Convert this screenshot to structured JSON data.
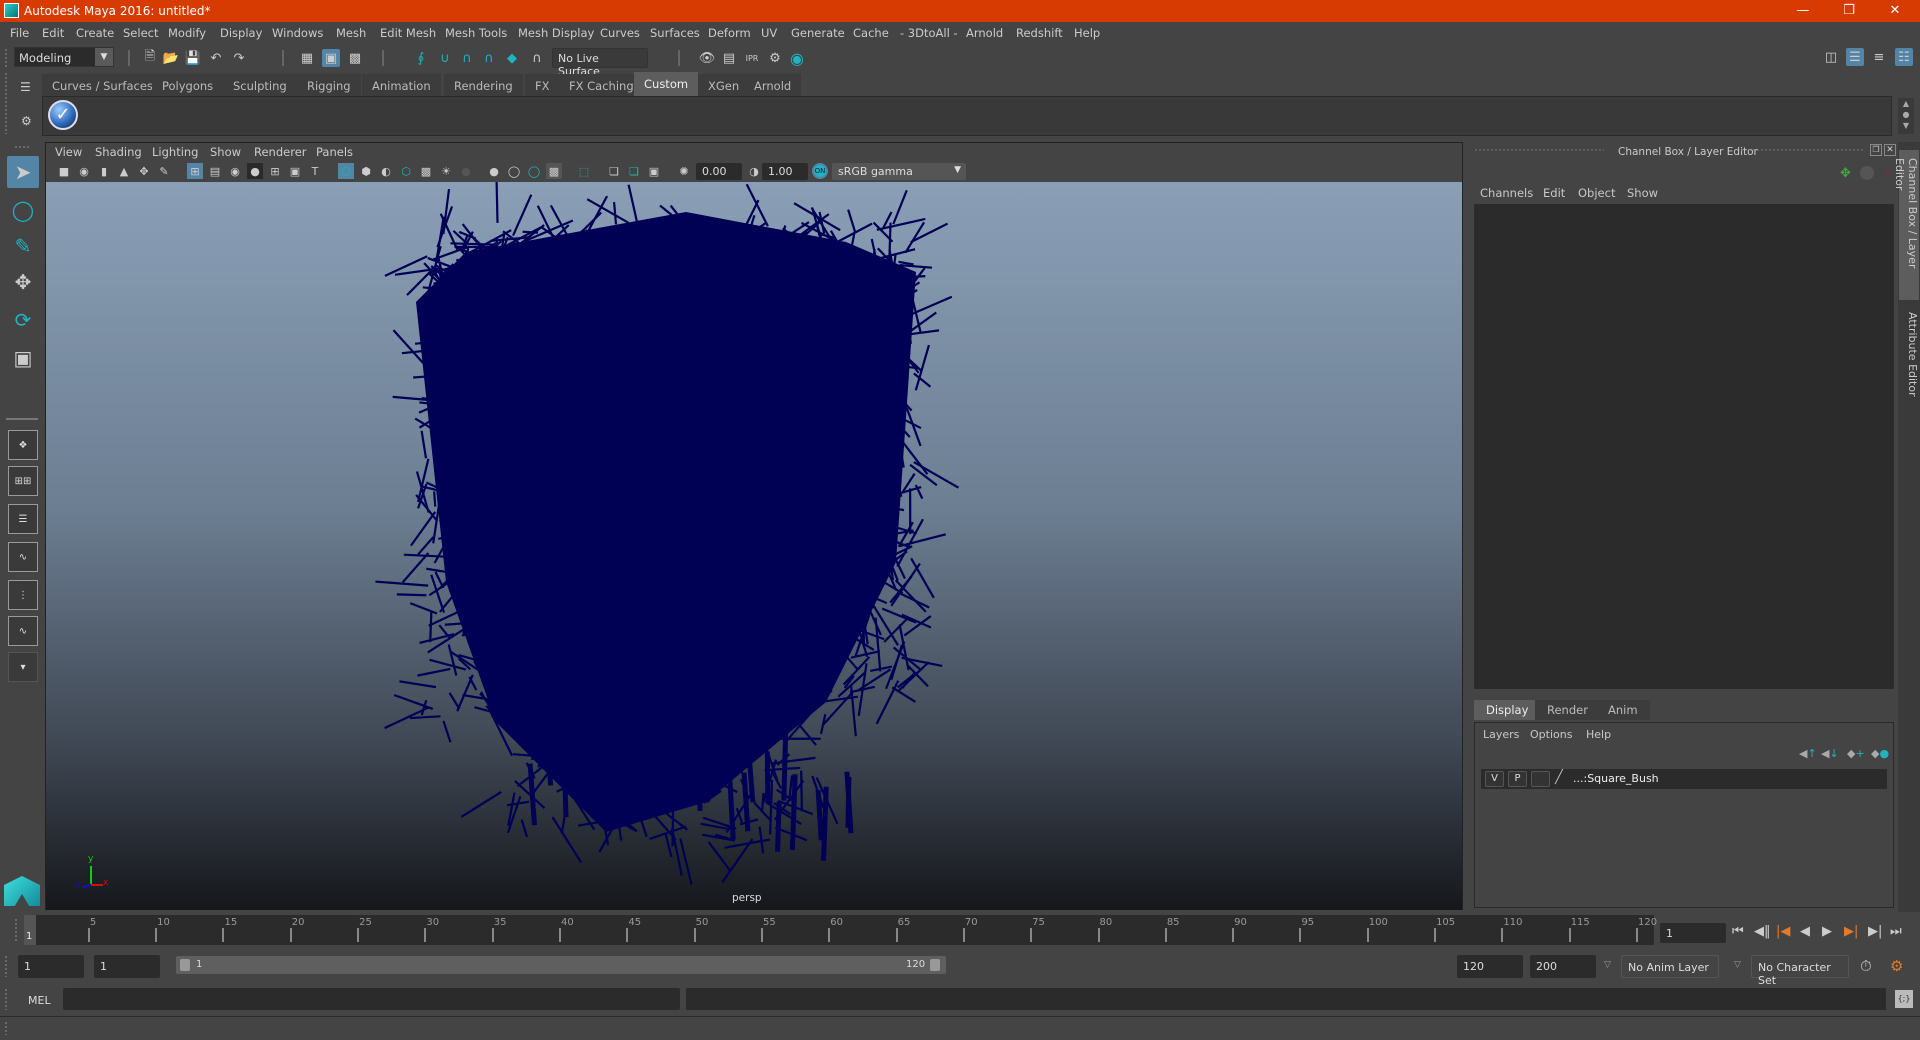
{
  "window": {
    "title": "Autodesk Maya 2016: untitled*",
    "controls": [
      "minimize",
      "restore",
      "close"
    ]
  },
  "menubar": [
    "File",
    "Edit",
    "Create",
    "Select",
    "Modify",
    "Display",
    "Windows",
    "Mesh",
    "Edit Mesh",
    "Mesh Tools",
    "Mesh Display",
    "Curves",
    "Surfaces",
    "Deform",
    "UV",
    "Generate",
    "Cache",
    "- 3DtoAll -",
    "Arnold",
    "Redshift",
    "Help"
  ],
  "statusline": {
    "mode": "Modeling",
    "live_surface": "No Live Surface"
  },
  "shelf": {
    "tabs": [
      "Curves / Surfaces",
      "Polygons",
      "Sculpting",
      "Rigging",
      "Animation",
      "Rendering",
      "FX",
      "FX Caching",
      "Custom",
      "XGen",
      "Arnold"
    ],
    "active_tab": "Custom"
  },
  "viewport": {
    "menu": [
      "View",
      "Shading",
      "Lighting",
      "Show",
      "Renderer",
      "Panels"
    ],
    "exposure": "0.00",
    "gamma": "1.00",
    "color_mgmt": "ON",
    "color_space": "sRGB gamma",
    "camera_label": "persp",
    "axis": {
      "x": "x",
      "y": "y",
      "z": "z"
    },
    "colors": {
      "mesh": "#000055",
      "bg_top": "#8a9fb6",
      "bg_bottom": "#15171b"
    }
  },
  "channel_box": {
    "title": "Channel Box / Layer Editor",
    "menu": [
      "Channels",
      "Edit",
      "Object",
      "Show"
    ]
  },
  "layer_editor": {
    "tabs": [
      "Display",
      "Render",
      "Anim"
    ],
    "active_tab": "Display",
    "menu": [
      "Layers",
      "Options",
      "Help"
    ],
    "layers": [
      {
        "v": "V",
        "p": "P",
        "name": "...:Square_Bush"
      }
    ]
  },
  "side_tabs": [
    "Channel Box / Layer Editor",
    "Attribute Editor"
  ],
  "timeline": {
    "ticks": [
      5,
      10,
      15,
      20,
      25,
      30,
      35,
      40,
      45,
      50,
      55,
      60,
      65,
      70,
      75,
      80,
      85,
      90,
      95,
      100,
      105,
      110,
      115,
      120
    ],
    "current_frame_marker": "1",
    "current_frame": "1",
    "min": 1,
    "max": 120
  },
  "range": {
    "start": "1",
    "playback_start": "1",
    "slider_start": "1",
    "slider_end": "120",
    "playback_end": "120",
    "end": "200",
    "anim_layer": "No Anim Layer",
    "character_set": "No Character Set"
  },
  "command": {
    "language": "MEL"
  },
  "accent_colors": {
    "selected": "#5285a6",
    "title": "#d83b01",
    "teal": "#1fb3c3",
    "orange": "#e07b2d"
  }
}
